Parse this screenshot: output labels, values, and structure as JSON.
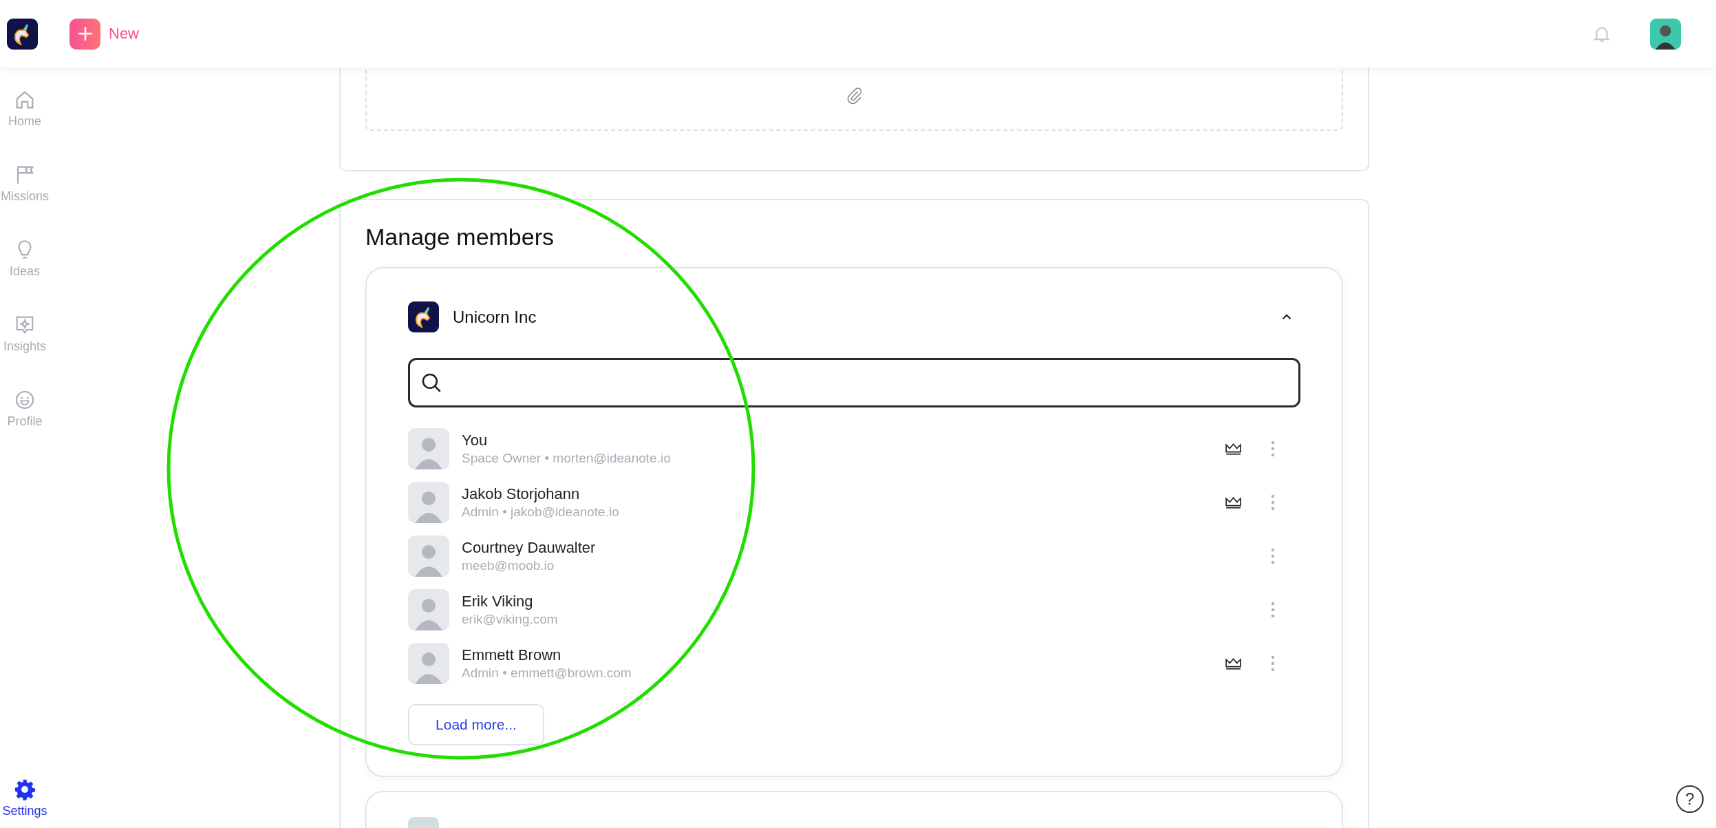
{
  "top_bar": {
    "new_button": {
      "label": "New"
    }
  },
  "sidebar": {
    "items": [
      {
        "label": "Home",
        "selected": false
      },
      {
        "label": "Missions",
        "selected": false
      },
      {
        "label": "Ideas",
        "selected": false
      },
      {
        "label": "Insights",
        "selected": false
      },
      {
        "label": "Profile",
        "selected": false
      },
      {
        "label": "Settings",
        "selected": true
      }
    ]
  },
  "manage_members": {
    "title": "Manage members",
    "groups": [
      {
        "name": "Unicorn Inc",
        "expanded": true,
        "members": [
          {
            "name": "You",
            "detail": "Space Owner • morten@ideanote.io",
            "admin": true
          },
          {
            "name": "Jakob Storjohann",
            "detail": "Admin • jakob@ideanote.io",
            "admin": true
          },
          {
            "name": "Courtney Dauwalter",
            "detail": "meeb@moob.io",
            "admin": false
          },
          {
            "name": "Erik Viking",
            "detail": "erik@viking.com",
            "admin": false
          },
          {
            "name": "Emmett Brown",
            "detail": "Admin • emmett@brown.com",
            "admin": true
          }
        ],
        "load_more": "Load more..."
      }
    ]
  },
  "help_button": {
    "label": "?"
  }
}
